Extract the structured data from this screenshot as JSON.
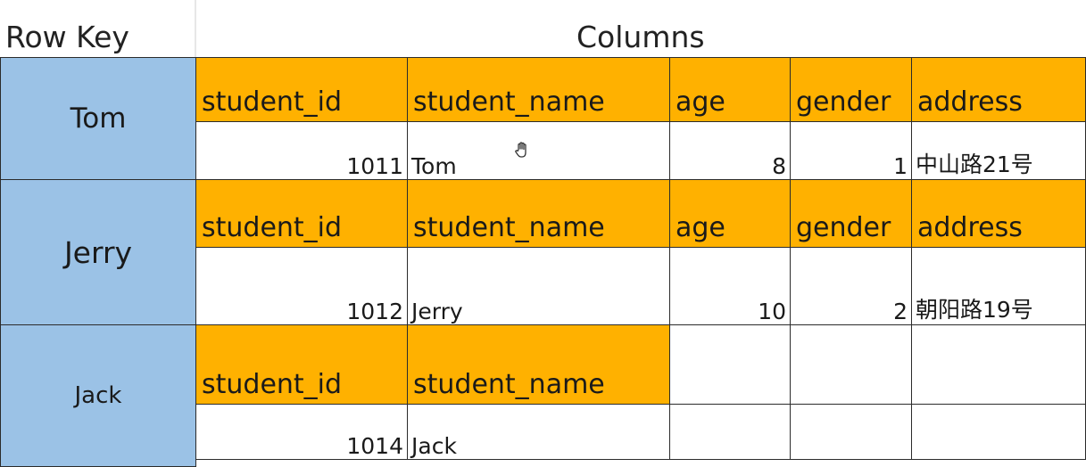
{
  "header": {
    "row_key_label": "Row Key",
    "columns_label": "Columns"
  },
  "rows": [
    {
      "key": "Tom",
      "columns": [
        "student_id",
        "student_name",
        "age",
        "gender",
        "address"
      ],
      "values": [
        "1011",
        "Tom",
        "8",
        "1",
        "中山路21号"
      ]
    },
    {
      "key": "Jerry",
      "columns": [
        "student_id",
        "student_name",
        "age",
        "gender",
        "address"
      ],
      "values": [
        "1012",
        "Jerry",
        "10",
        "2",
        "朝阳路19号"
      ]
    },
    {
      "key": "Jack",
      "columns": [
        "student_id",
        "student_name"
      ],
      "values": [
        "1014",
        "Jack"
      ]
    }
  ],
  "colors": {
    "row_key_bg": "#9bc2e6",
    "column_name_bg": "#ffb100",
    "value_bg": "#ffffff"
  },
  "icons": {
    "cursor": "hand-cursor-icon"
  }
}
